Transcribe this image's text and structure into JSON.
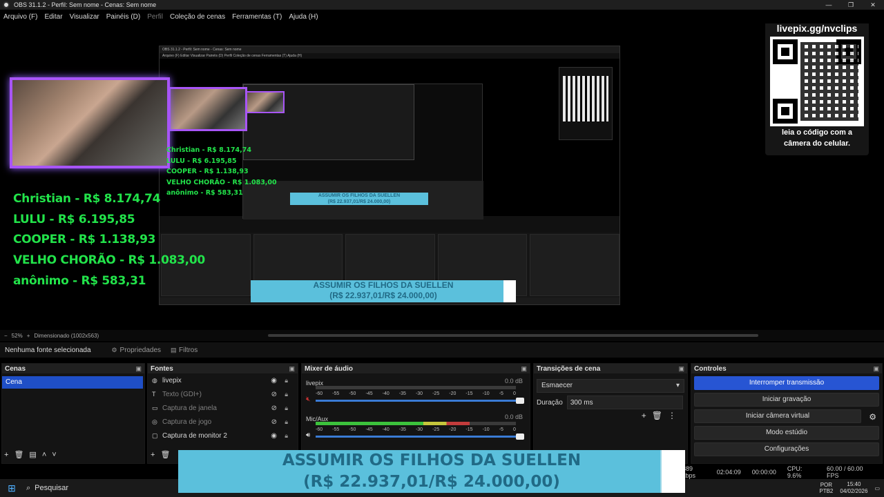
{
  "window": {
    "title": "OBS 31.1.2 - Perfil: Sem nome - Cenas: Sem nome",
    "controls": [
      "—",
      "❐",
      "✕"
    ]
  },
  "menu": [
    {
      "label": "Arquivo (F)",
      "enabled": true
    },
    {
      "label": "Editar",
      "enabled": true
    },
    {
      "label": "Visualizar",
      "enabled": true
    },
    {
      "label": "Painéis (D)",
      "enabled": true
    },
    {
      "label": "Perfil",
      "enabled": false
    },
    {
      "label": "Coleção de cenas",
      "enabled": true
    },
    {
      "label": "Ferramentas (T)",
      "enabled": true
    },
    {
      "label": "Ajuda (H)",
      "enabled": true
    }
  ],
  "overlay": {
    "donors": [
      "Christian - R$ 8.174,74",
      "LULU - R$ 6.195,85",
      "COOPER - R$ 1.138,93",
      "VELHO CHORÃO - R$ 1.083,00",
      "anônimo - R$ 583,31"
    ],
    "qr_link": "livepix.gg/nvclips",
    "qr_caption_line1": "leia o código com a",
    "qr_caption_line2": "câmera do celular.",
    "goal_line1": "ASSUMIR OS FILHOS DA SUELLEN",
    "goal_line2": "(R$ 22.937,01/R$ 24.000,00)",
    "goal_progress": 0.956,
    "accent_color": "#22e34a",
    "goal_color": "#5bc0dc",
    "cam_border_color": "#a855f7"
  },
  "nested": {
    "title": "OBS 31.1.2 - Perfil: Sem nome - Cenas: Sem nome",
    "menu": "Arquivo (F)   Editar   Visualizar   Painéis (D)   Perfil   Coleção de cenas   Ferramentas (T)   Ajuda (H)"
  },
  "preview_status": {
    "zoom": "52%",
    "scaled": "Dimensionado (1002x563)"
  },
  "source_toolbar": {
    "no_source": "Nenhuma fonte selecionada",
    "properties": "Propriedades",
    "filters": "Filtros"
  },
  "scenes": {
    "title": "Cenas",
    "items": [
      "Cena"
    ]
  },
  "sources": {
    "title": "Fontes",
    "items": [
      {
        "label": "livepix",
        "icon": "globe-icon",
        "visible": true
      },
      {
        "label": "Texto (GDI+)",
        "icon": "text-icon",
        "visible": false
      },
      {
        "label": "Captura de janela",
        "icon": "window-icon",
        "visible": false
      },
      {
        "label": "Captura de jogo",
        "icon": "gamepad-icon",
        "visible": false
      },
      {
        "label": "Captura de monitor 2",
        "icon": "monitor-icon",
        "visible": true
      }
    ]
  },
  "mixer": {
    "title": "Mixer de áudio",
    "scale": [
      "-60",
      "-55",
      "-50",
      "-45",
      "-40",
      "-35",
      "-30",
      "-25",
      "-20",
      "-15",
      "-10",
      "-5",
      "0"
    ],
    "channels": [
      {
        "name": "livepix",
        "db": "0.0 dB",
        "level": 0.0
      },
      {
        "name": "Mic/Aux",
        "db": "0.0 dB",
        "level": 0.77
      }
    ]
  },
  "transitions": {
    "title": "Transições de cena",
    "selected": "Esmaecer",
    "duration_label": "Duração",
    "duration_value": "300 ms"
  },
  "controls": {
    "title": "Controles",
    "stop_stream": "Interromper transmissão",
    "start_recording": "Iniciar gravação",
    "start_virtual_cam": "Iniciar câmera virtual",
    "studio_mode": "Modo estúdio",
    "settings": "Configurações"
  },
  "status": {
    "bitrate": "889 kbps",
    "stream_time": "02:04:09",
    "rec_time": "00:00:00",
    "cpu": "CPU: 9.6%",
    "fps": "60.00 / 60.00 FPS"
  },
  "taskbar": {
    "search": "Pesquisar",
    "lang1": "POR",
    "lang2": "PTB2",
    "time": "15:40",
    "date": "04/02/2026"
  }
}
